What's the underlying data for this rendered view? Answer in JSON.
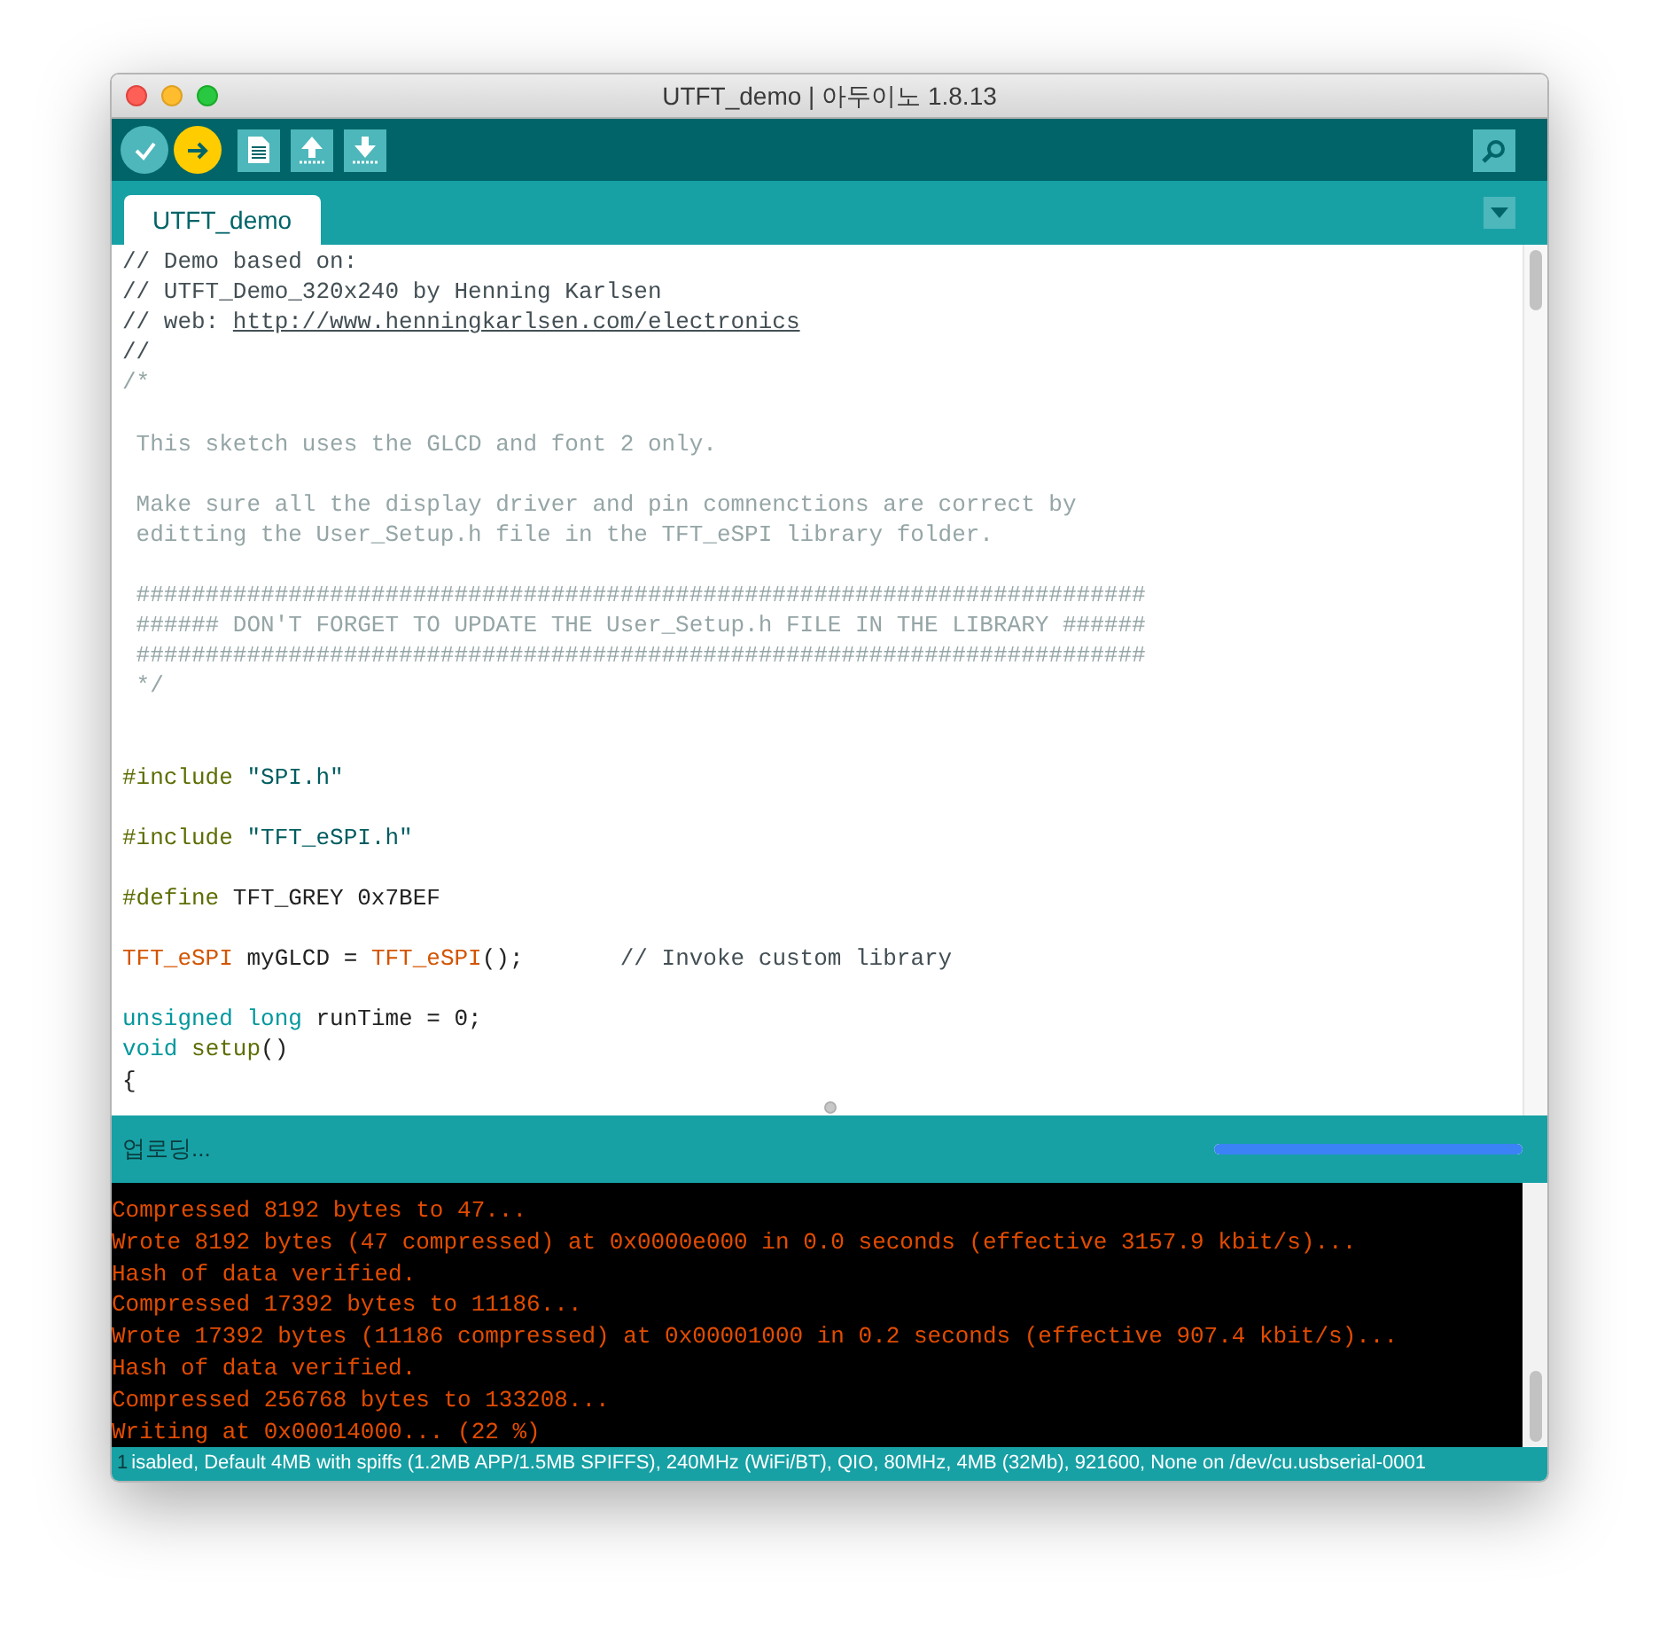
{
  "window": {
    "title": "UTFT_demo | 아두이노 1.8.13"
  },
  "toolbar": {
    "buttons": [
      {
        "kind": "verify",
        "active": false
      },
      {
        "kind": "upload",
        "active": true
      },
      {
        "kind": "new",
        "active": false
      },
      {
        "kind": "open",
        "active": false
      },
      {
        "kind": "save",
        "active": false
      }
    ]
  },
  "tabs": [
    {
      "label": "UTFT_demo",
      "selected": true
    }
  ],
  "editor": {
    "lines": [
      {
        "kind": "code",
        "tokens": [
          {
            "kind": "comment_dark",
            "text": "// Demo based on:"
          }
        ]
      },
      {
        "kind": "code",
        "tokens": [
          {
            "kind": "comment_dark",
            "text": "// UTFT_Demo_320x240 by Henning Karlsen"
          }
        ]
      },
      {
        "kind": "code",
        "tokens": [
          {
            "kind": "comment_dark",
            "text": "// web: "
          },
          {
            "kind": "link",
            "text": "http://www.henningkarlsen.com/electronics"
          }
        ]
      },
      {
        "kind": "code",
        "tokens": [
          {
            "kind": "comment_dark",
            "text": "//"
          }
        ]
      },
      {
        "kind": "code",
        "tokens": [
          {
            "kind": "comment",
            "text": "/*"
          }
        ]
      },
      {
        "kind": "blank"
      },
      {
        "kind": "code",
        "tokens": [
          {
            "kind": "comment",
            "text": " This sketch uses the GLCD and font 2 only."
          }
        ]
      },
      {
        "kind": "blank"
      },
      {
        "kind": "code",
        "tokens": [
          {
            "kind": "comment",
            "text": " Make sure all the display driver and pin comnenctions are correct by"
          }
        ]
      },
      {
        "kind": "code",
        "tokens": [
          {
            "kind": "comment",
            "text": " editting the User_Setup.h file in the TFT_eSPI library folder."
          }
        ]
      },
      {
        "kind": "blank"
      },
      {
        "kind": "code",
        "tokens": [
          {
            "kind": "comment",
            "text": " #########################################################################"
          }
        ]
      },
      {
        "kind": "code",
        "tokens": [
          {
            "kind": "comment",
            "text": " ###### DON'T FORGET TO UPDATE THE User_Setup.h FILE IN THE LIBRARY ######"
          }
        ]
      },
      {
        "kind": "code",
        "tokens": [
          {
            "kind": "comment",
            "text": " #########################################################################"
          }
        ]
      },
      {
        "kind": "code",
        "tokens": [
          {
            "kind": "comment",
            "text": " */"
          }
        ]
      },
      {
        "kind": "blank"
      },
      {
        "kind": "blank"
      },
      {
        "kind": "code",
        "tokens": [
          {
            "kind": "preproc",
            "text": "#include"
          },
          {
            "kind": "string",
            "text": " \"SPI.h\""
          }
        ]
      },
      {
        "kind": "blank"
      },
      {
        "kind": "code",
        "tokens": [
          {
            "kind": "preproc",
            "text": "#include"
          },
          {
            "kind": "string",
            "text": " \"TFT_eSPI.h\""
          }
        ]
      },
      {
        "kind": "blank"
      },
      {
        "kind": "code",
        "tokens": [
          {
            "kind": "preproc",
            "text": "#define"
          },
          {
            "kind": "plain",
            "text": " TFT_GREY 0x7BEF"
          }
        ]
      },
      {
        "kind": "blank"
      },
      {
        "kind": "code",
        "tokens": [
          {
            "kind": "type",
            "text": "TFT_eSPI"
          },
          {
            "kind": "plain",
            "text": " myGLCD = "
          },
          {
            "kind": "type",
            "text": "TFT_eSPI"
          },
          {
            "kind": "plain",
            "text": "();       "
          },
          {
            "kind": "comment_dark",
            "text": "// Invoke custom library"
          }
        ]
      },
      {
        "kind": "blank"
      },
      {
        "kind": "code",
        "tokens": [
          {
            "kind": "keyword",
            "text": "unsigned"
          },
          {
            "kind": "keyword",
            "text": " long"
          },
          {
            "kind": "plain",
            "text": " runTime = 0;"
          }
        ]
      },
      {
        "kind": "code",
        "tokens": [
          {
            "kind": "keyword",
            "text": "void"
          },
          {
            "kind": "preproc",
            "text": " setup"
          },
          {
            "kind": "plain",
            "text": "()"
          }
        ]
      },
      {
        "kind": "code",
        "tokens": [
          {
            "kind": "plain",
            "text": "{"
          }
        ]
      }
    ]
  },
  "progress": {
    "label": "업로딩...",
    "level": 1
  },
  "console": {
    "lines": [
      "Compressed 8192 bytes to 47...",
      "Wrote 8192 bytes (47 compressed) at 0x0000e000 in 0.0 seconds (effective 3157.9 kbit/s)...",
      "Hash of data verified.",
      "Compressed 17392 bytes to 11186...",
      "Wrote 17392 bytes (11186 compressed) at 0x00001000 in 0.2 seconds (effective 907.4 kbit/s)...",
      "Hash of data verified.",
      "Compressed 256768 bytes to 133208...",
      "Writing at 0x00014000... (22 %)"
    ]
  },
  "status_bar": {
    "line_number": "1",
    "board": "isabled, Default 4MB with spiffs (1.2MB APP/1.5MB SPIFFS), 240MHz (WiFi/BT), QIO, 80MHz, 4MB (32Mb), 921600, None on /dev/cu.usbserial-0001"
  }
}
